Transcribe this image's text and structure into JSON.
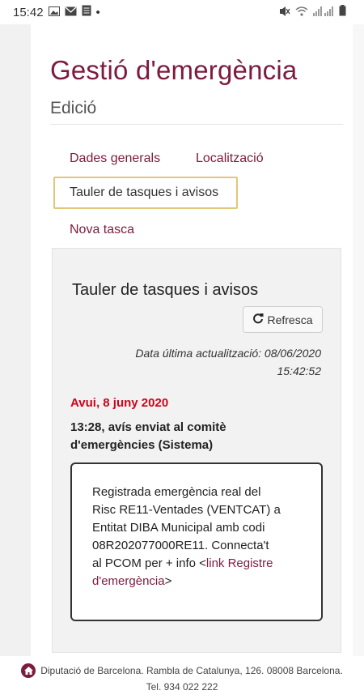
{
  "status_bar": {
    "time": "15:42",
    "dot": "•"
  },
  "page": {
    "title": "Gestió d'emergència",
    "subtitle": "Edició"
  },
  "tabs": [
    {
      "label": "Dades generals"
    },
    {
      "label": "Localització"
    },
    {
      "label": "Tauler de tasques i avisos",
      "active": true
    },
    {
      "label": "Nova tasca"
    }
  ],
  "panel": {
    "title": "Tauler de tasques i avisos",
    "refresh_label": "Refresca",
    "last_update_line1": "Data última actualització: 08/06/2020",
    "last_update_line2": "15:42:52",
    "date_heading": "Avui, 8 juny 2020",
    "event_line1": "13:28, avís enviat al comitè",
    "event_line2": "d'emergències (Sistema)",
    "message": {
      "lines": [
        "Registrada emergència real del",
        "Risc RE11-Ventades (VENTCAT) a",
        "Entitat DIBA Municipal amb codi",
        "08R202077000RE11. Connecta't",
        "al PCOM per + info <"
      ],
      "link_part1": "link Registre",
      "link_part2": "d'emergència",
      "tail": ">"
    }
  },
  "footer": {
    "line1": "Diputació de Barcelona. Rambla de Catalunya, 126. 08008 Barcelona.",
    "line2": "Tel. 934 022 222"
  },
  "colors": {
    "brand": "#7d1b3f",
    "date_red": "#d0021b",
    "active_tab_border": "#e2c77a"
  }
}
